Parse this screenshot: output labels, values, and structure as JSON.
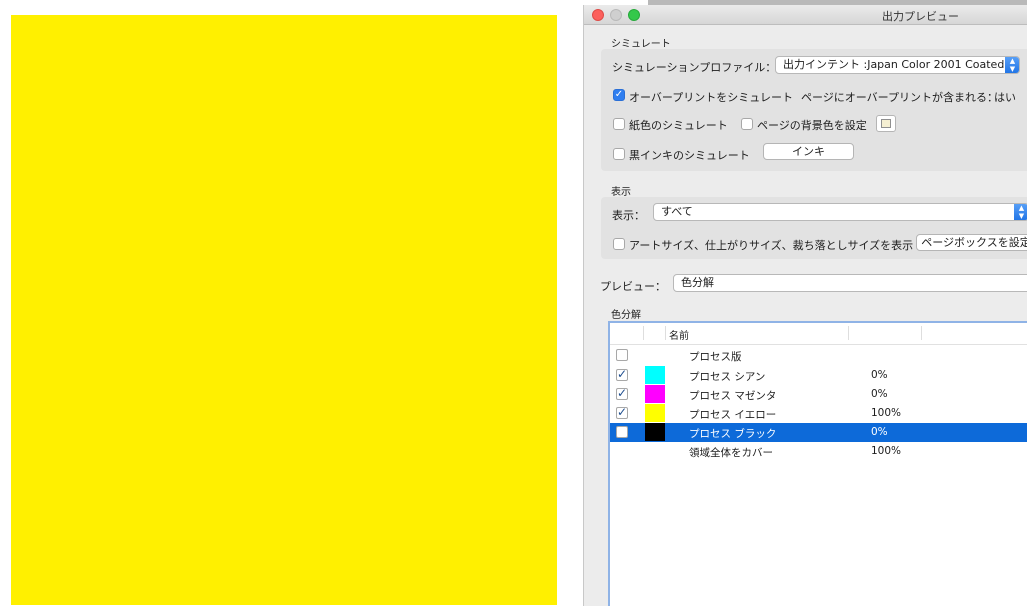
{
  "window": {
    "title": "出力プレビュー"
  },
  "simulate": {
    "section_label": "シミュレート",
    "profile_label": "シミュレーションプロファイル：",
    "profile_value": "出力インテント :Japan Color 2001 Coated",
    "overprint_label": "オーバープリントをシミュレート",
    "overprint_checked": true,
    "overprint_info_label": "ページにオーバープリントが含まれる：",
    "overprint_info_value": "はい",
    "paper_color_label": "紙色のシミュレート",
    "page_bg_label": "ページの背景色を設定",
    "black_ink_label": "黒インキのシミュレート",
    "ink_button": "インキ"
  },
  "display": {
    "section_label": "表示",
    "show_label": "表示：",
    "show_value": "すべて",
    "art_size_label": "アートサイズ、仕上がりサイズ、裁ち落としサイズを表示",
    "page_box_button": "ページボックスを設定"
  },
  "preview": {
    "label": "プレビュー：",
    "value": "色分解"
  },
  "separations": {
    "section_label": "色分解",
    "columns": {
      "name": "名前"
    },
    "rows": [
      {
        "name": "プロセス版",
        "checked": false,
        "swatch": "",
        "coverage": ""
      },
      {
        "name": "プロセス シアン",
        "checked": true,
        "swatch": "#00ffff",
        "coverage": "0%"
      },
      {
        "name": "プロセス マゼンタ",
        "checked": true,
        "swatch": "#ff00ff",
        "coverage": "0%"
      },
      {
        "name": "プロセス イエロー",
        "checked": true,
        "swatch": "#ffff00",
        "coverage": "100%"
      },
      {
        "name": "プロセス ブラック",
        "checked": false,
        "swatch": "#000000",
        "coverage": "0%",
        "selected": true
      },
      {
        "name": "領域全体をカバー",
        "checked": null,
        "swatch": "",
        "coverage": "100%"
      }
    ]
  },
  "colors": {
    "document_page": "#fff000",
    "selection": "#0d6ad9",
    "accent": "#2f7ef0"
  }
}
